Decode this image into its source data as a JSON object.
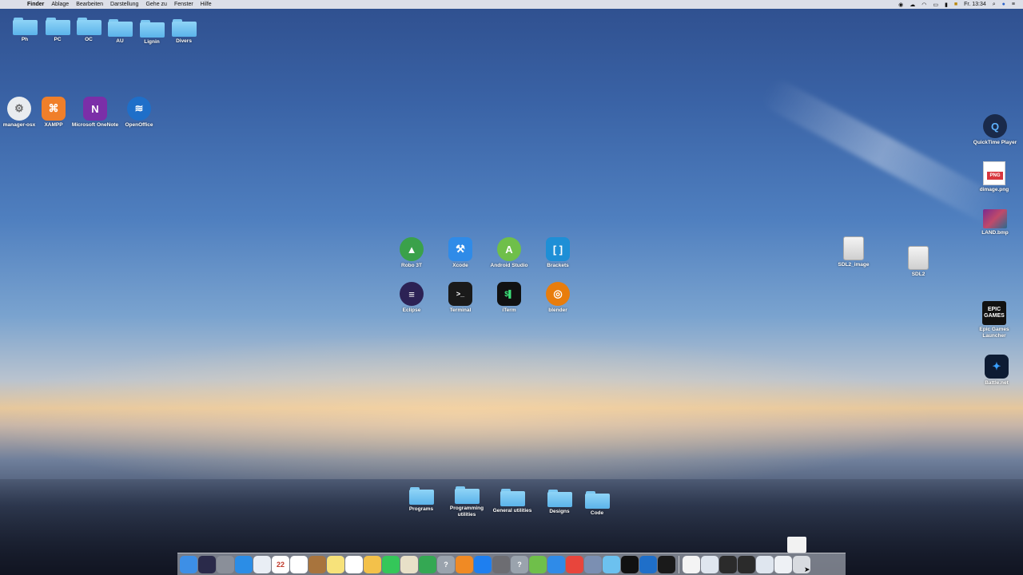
{
  "menubar": {
    "apple_glyph": "",
    "items": [
      "Finder",
      "Ablage",
      "Bearbeiten",
      "Darstellung",
      "Gehe zu",
      "Fenster",
      "Hilfe"
    ],
    "status_icons": [
      "record-icon",
      "cloud-icon",
      "wifi-icon",
      "airplay-icon",
      "battery-icon",
      "flag-de-icon"
    ],
    "clock": "Fr. 13:34",
    "right_icons": [
      "search-icon",
      "user-icon",
      "control-center-icon"
    ]
  },
  "desktop": {
    "top_folders": [
      "Ph",
      "PC",
      "OC",
      "AU",
      "Lignin",
      "Divers"
    ],
    "top_apps": [
      "manager-osx",
      "XAMPP",
      "Microsoft OneNote",
      "OpenOffice"
    ],
    "center_apps": [
      {
        "label": "Robo 3T",
        "icon": "robo3t-icon",
        "color": "#3aa14a"
      },
      {
        "label": "Xcode",
        "icon": "xcode-icon",
        "color": "#2f8be8"
      },
      {
        "label": "Android Studio",
        "icon": "android-studio-icon",
        "color": "#6fbf4a"
      },
      {
        "label": "Brackets",
        "icon": "brackets-icon",
        "color": "#1e8fd6"
      },
      {
        "label": "Eclipse",
        "icon": "eclipse-icon",
        "color": "#2c2255"
      },
      {
        "label": "Terminal",
        "icon": "terminal-icon",
        "color": "#1a1a1a"
      },
      {
        "label": "iTerm",
        "icon": "iterm-icon",
        "color": "#111111"
      },
      {
        "label": "blender",
        "icon": "blender-icon",
        "color": "#e87d0d"
      }
    ],
    "right_items": [
      {
        "label": "QuickTime Player",
        "icon": "quicktime-icon"
      },
      {
        "label": "dimage.png",
        "icon": "png-file-icon",
        "tag": "PNG"
      },
      {
        "label": "LAND.bmp",
        "icon": "bmp-file-icon"
      },
      {
        "label": "Epic Games Launcher",
        "icon": "epic-games-icon",
        "logo": "EPIC GAMES"
      },
      {
        "label": "Battle.net",
        "icon": "battlenet-icon"
      }
    ],
    "disks": [
      "SDL2_image",
      "SDL2"
    ],
    "bottom_folders": [
      "Programs",
      "Programming utilities",
      "General utilities",
      "Designs",
      "Code"
    ]
  },
  "dock": {
    "items": [
      {
        "name": "finder-icon",
        "color": "#3d8fe6"
      },
      {
        "name": "siri-icon",
        "color": "#2a2a4a"
      },
      {
        "name": "launchpad-icon",
        "color": "#8a8f99"
      },
      {
        "name": "safari-icon",
        "color": "#2b8de6"
      },
      {
        "name": "mail-icon",
        "color": "#e9eef5"
      },
      {
        "name": "calendar-icon",
        "color": "#ffffff",
        "text": "22"
      },
      {
        "name": "apps-grid-icon",
        "color": "#ffffff"
      },
      {
        "name": "notes-brown-icon",
        "color": "#a8743d"
      },
      {
        "name": "notes-icon",
        "color": "#f7e27a"
      },
      {
        "name": "reminders-icon",
        "color": "#ffffff"
      },
      {
        "name": "photos-icon",
        "color": "#f3c14a"
      },
      {
        "name": "facetime-icon",
        "color": "#34c759"
      },
      {
        "name": "preview-icon",
        "color": "#e8e0c8"
      },
      {
        "name": "numbers-icon",
        "color": "#34a853"
      },
      {
        "name": "help-icon",
        "color": "#9aa3ad",
        "text": "?"
      },
      {
        "name": "books-icon",
        "color": "#f08a24"
      },
      {
        "name": "app-store-icon",
        "color": "#1e7ff0"
      },
      {
        "name": "system-preferences-icon",
        "color": "#6d6d72"
      },
      {
        "name": "help2-icon",
        "color": "#9aa3ad",
        "text": "?"
      },
      {
        "name": "android-studio-dock-icon",
        "color": "#6fbf4a"
      },
      {
        "name": "xcode-dock-icon",
        "color": "#2f8be8"
      },
      {
        "name": "chrome-icon",
        "color": "#e8453c"
      },
      {
        "name": "image-viewer-icon",
        "color": "#7b8fb2"
      },
      {
        "name": "folder-dock-icon",
        "color": "#6cc1ef"
      },
      {
        "name": "iterm-dock-icon",
        "color": "#111111"
      },
      {
        "name": "openoffice-dock-icon",
        "color": "#1f6fc9"
      },
      {
        "name": "quicktime-dock-icon",
        "color": "#1a1a1a"
      }
    ],
    "right_items": [
      {
        "name": "document-icon",
        "color": "#f4f4f4"
      },
      {
        "name": "window-preview-1-icon",
        "color": "#dfe6ef"
      },
      {
        "name": "window-preview-2-icon",
        "color": "#2b2b2b"
      },
      {
        "name": "window-preview-3-icon",
        "color": "#2b2b2b"
      },
      {
        "name": "window-preview-4-icon",
        "color": "#dfe6ef"
      },
      {
        "name": "downloads-icon",
        "color": "#eef1f5"
      },
      {
        "name": "trash-icon",
        "color": "#d8dbe0"
      }
    ]
  }
}
